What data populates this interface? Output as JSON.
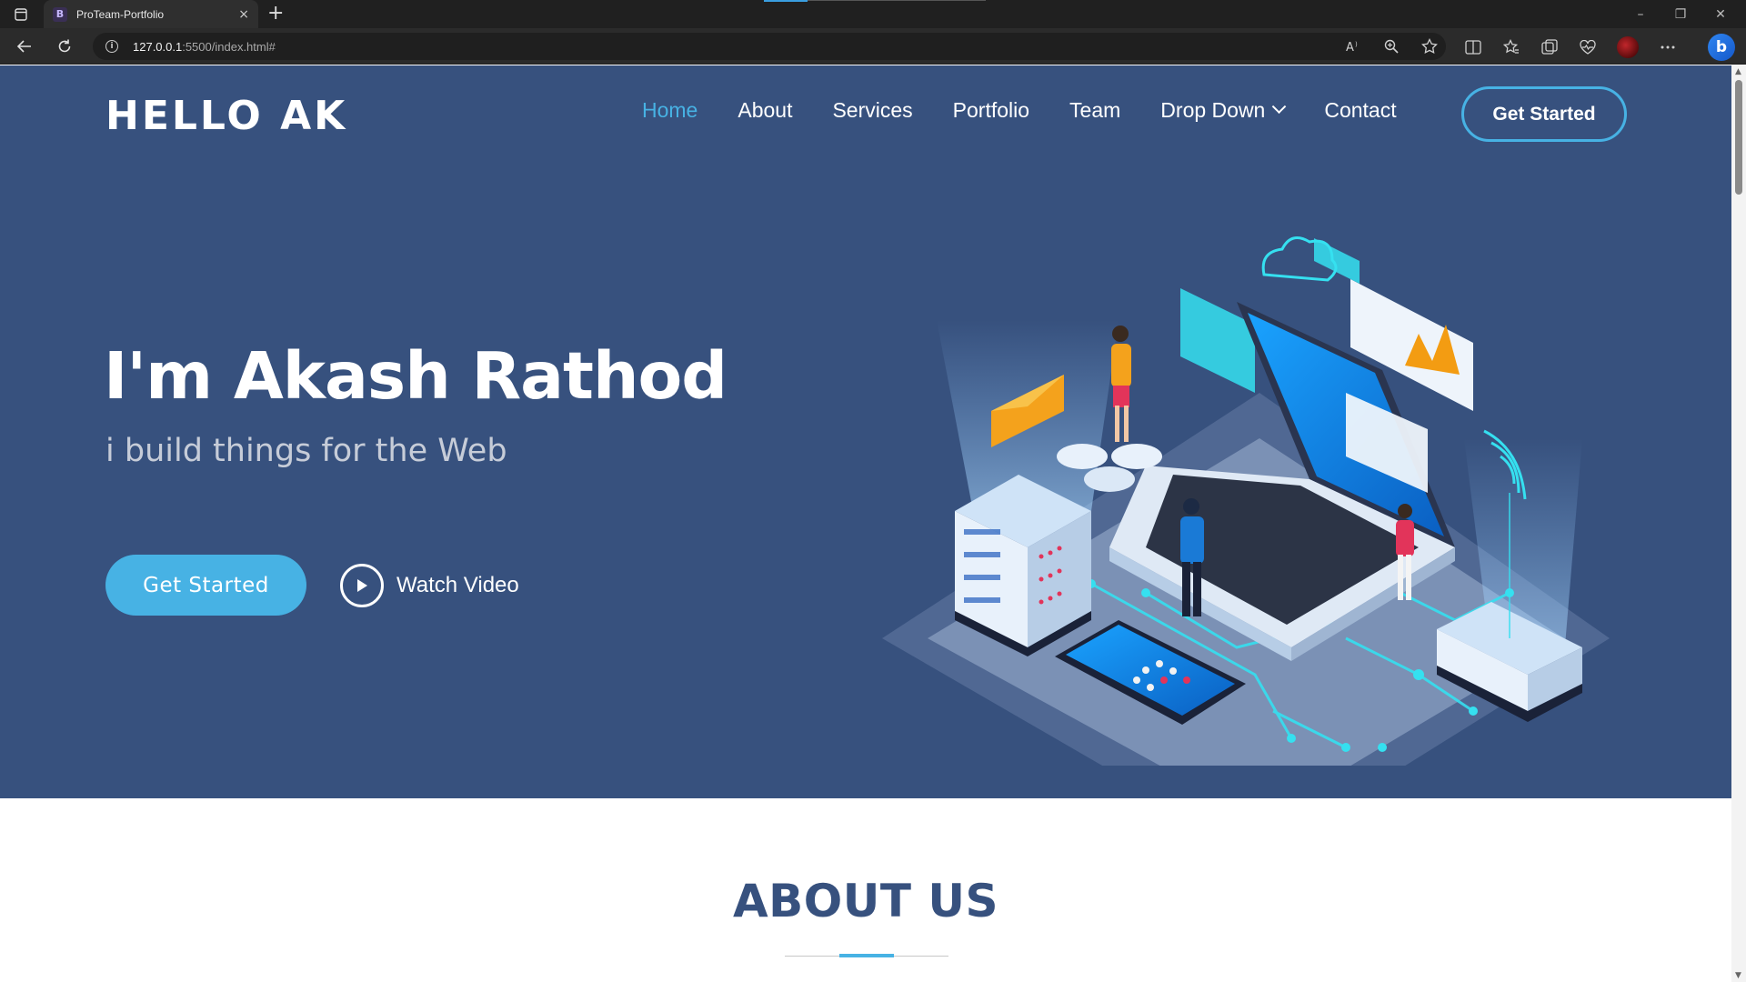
{
  "browser": {
    "tab_title": "ProTeam-Portfolio",
    "tab_favicon": "B",
    "new_tab": "+",
    "tab_close": "×",
    "url_host": "127.0.0.1",
    "url_rest": ":5500/index.html#",
    "window_controls": {
      "minimize": "–",
      "restore": "❐",
      "close": "✕"
    },
    "copilot_label": "b"
  },
  "site": {
    "logo": "HELLO AK",
    "nav": [
      {
        "label": "Home",
        "active": true
      },
      {
        "label": "About"
      },
      {
        "label": "Services"
      },
      {
        "label": "Portfolio"
      },
      {
        "label": "Team"
      },
      {
        "label": "Drop Down",
        "dropdown": true
      },
      {
        "label": "Contact"
      }
    ],
    "nav_cta": "Get Started",
    "hero": {
      "title": "I'm Akash Rathod",
      "subtitle": "i build things for the Web",
      "primary_button": "Get Started",
      "video_button": "Watch Video"
    },
    "about": {
      "title": "ABOUT US"
    }
  },
  "colors": {
    "hero_bg": "#37517e",
    "accent": "#47b2e4",
    "heading_dark": "#37517e"
  }
}
